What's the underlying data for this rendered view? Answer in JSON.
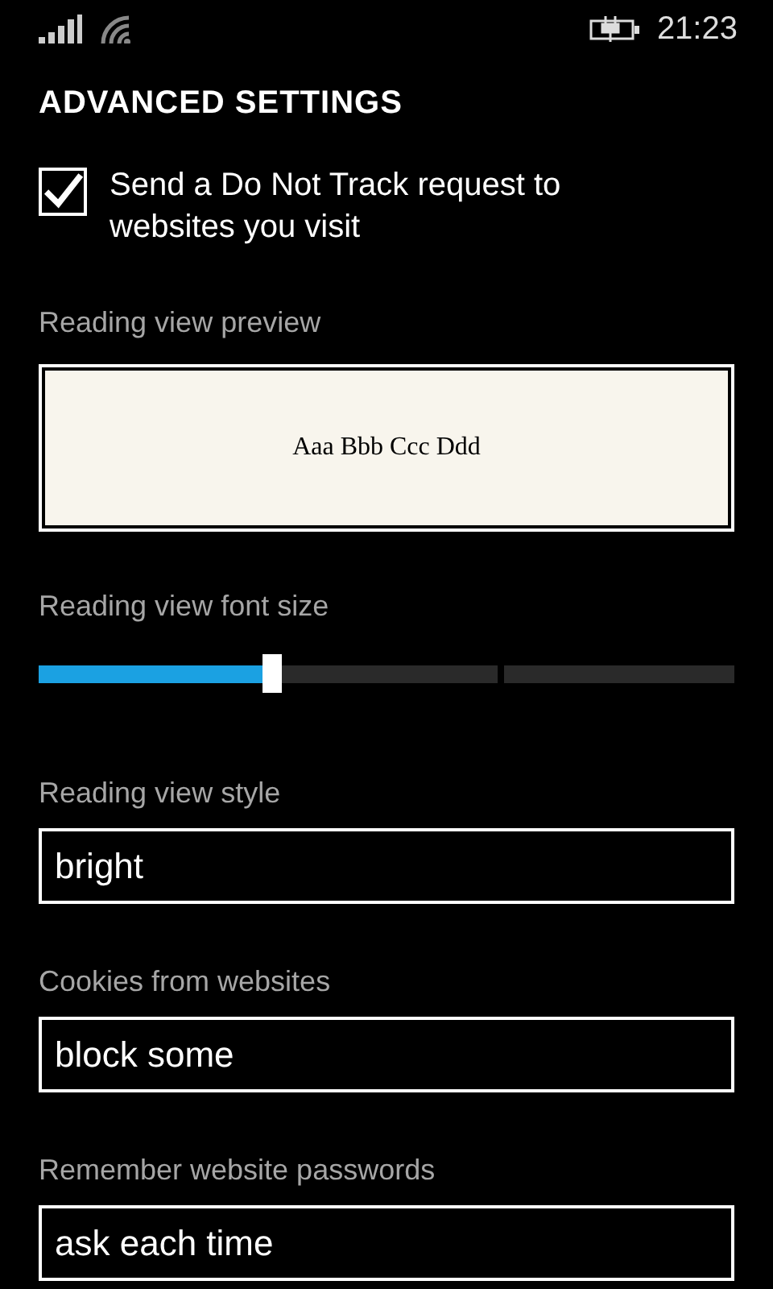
{
  "status_bar": {
    "time": "21:23"
  },
  "title": "ADVANCED SETTINGS",
  "do_not_track": {
    "label": "Send a Do Not Track request to websites you visit",
    "checked": true
  },
  "preview": {
    "label": "Reading view preview",
    "sample": "Aaa Bbb Ccc Ddd"
  },
  "font_size": {
    "label": "Reading view font size",
    "level": 0.335
  },
  "pickers": [
    {
      "label": "Reading view style",
      "value": "bright"
    },
    {
      "label": "Cookies from websites",
      "value": "block some"
    },
    {
      "label": "Remember website passwords",
      "value": "ask each time"
    }
  ]
}
